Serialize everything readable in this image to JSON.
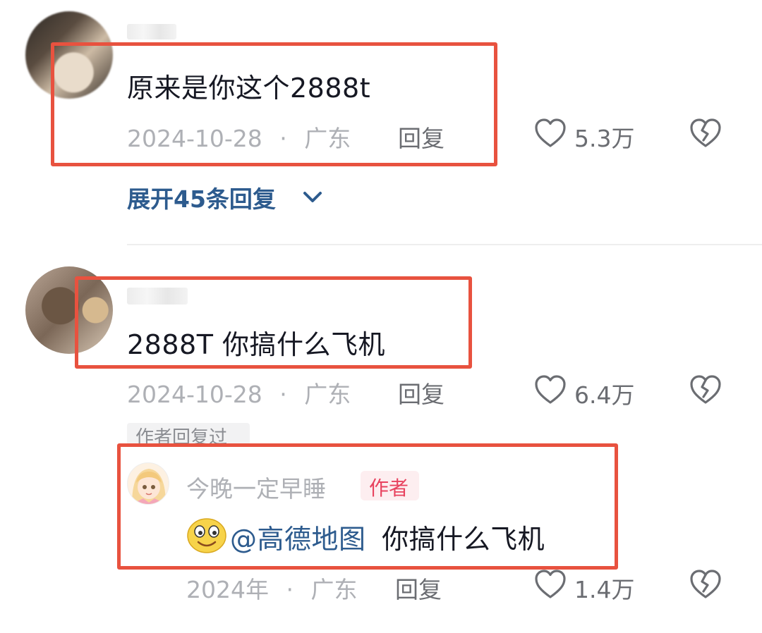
{
  "comments": [
    {
      "text": "原来是你这个2888t",
      "date": "2024-10-28",
      "location": "广东",
      "reply_label": "回复",
      "like_count": "5.3万",
      "expand_replies": "展开45条回复"
    },
    {
      "text": "2888T 你搞什么飞机",
      "date": "2024-10-28",
      "location": "广东",
      "reply_label": "回复",
      "like_count": "6.4万",
      "author_replied_tag": "作者回复过",
      "reply": {
        "username": "今晚一定早睡",
        "badge": "作者",
        "mention": "@高德地图",
        "text": "你搞什么飞机",
        "date": "2024年",
        "location": "广东",
        "reply_label": "回复",
        "like_count": "1.4万"
      }
    }
  ],
  "separator": "·",
  "icons": {
    "like": "heart-outline-icon",
    "dislike": "broken-heart-icon",
    "expand": "chevron-down-icon",
    "emoji": "smile-emoji-icon"
  },
  "colors": {
    "highlight_box": "#e8523f",
    "link": "#2d5b8e",
    "author_badge": "#e8435f"
  }
}
